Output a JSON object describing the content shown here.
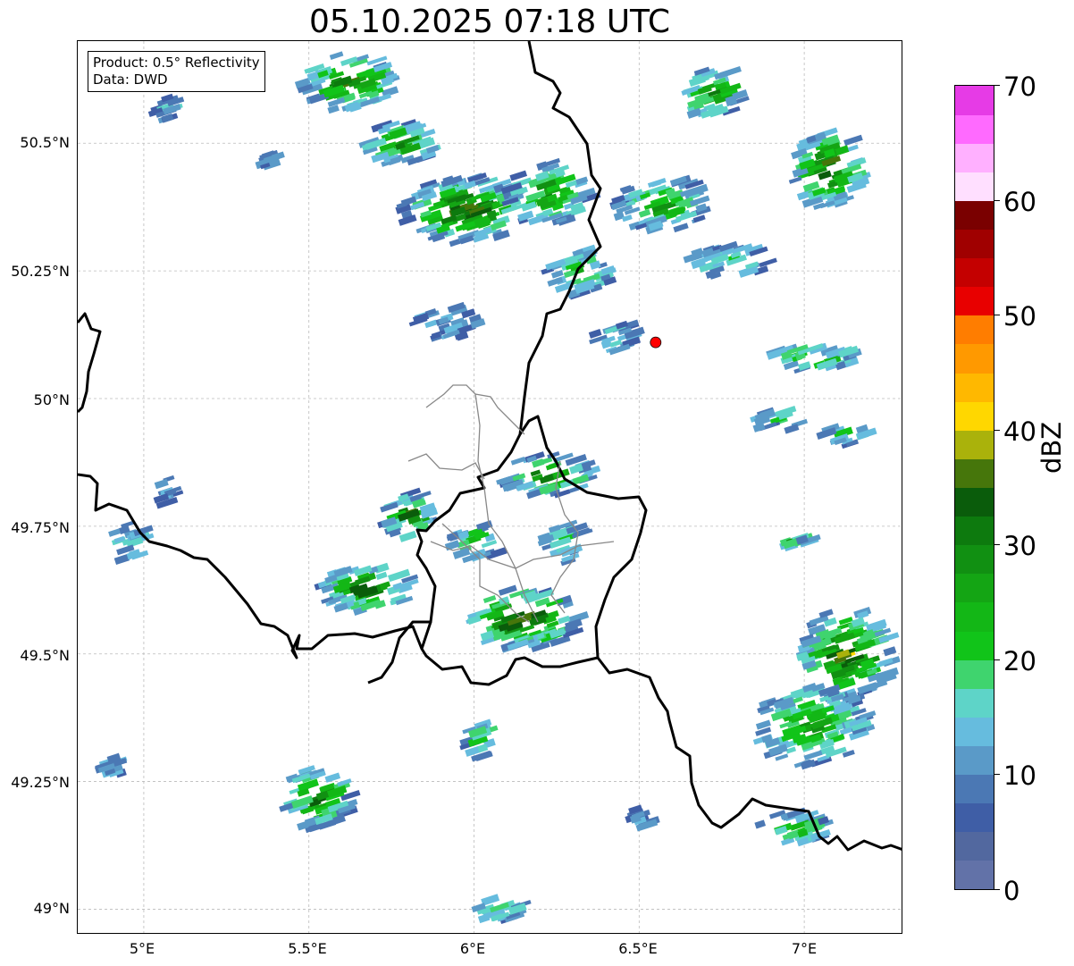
{
  "title": "05.10.2025 07:18 UTC",
  "infobox": {
    "product": "Product: 0.5° Reflectivity",
    "source": "Data: DWD"
  },
  "axes": {
    "lat_labels": [
      "50.5°N",
      "50.25°N",
      "50°N",
      "49.75°N",
      "49.5°N",
      "49.25°N",
      "49°N"
    ],
    "lon_labels": [
      "5°E",
      "5.5°E",
      "6°E",
      "6.5°E",
      "7°E"
    ],
    "lon_range": [
      4.8,
      7.3
    ],
    "lat_range": [
      48.95,
      50.7
    ],
    "grid": true
  },
  "radar_site": {
    "lon": 6.55,
    "lat": 50.11,
    "color": "#ff0000"
  },
  "colorbar": {
    "unit": "dBZ",
    "min": 0,
    "max": 70,
    "tick_labels": [
      "0",
      "10",
      "20",
      "30",
      "40",
      "50",
      "60",
      "70"
    ],
    "colors": [
      "#6272a8",
      "#52689f",
      "#3f5ea6",
      "#4b78b4",
      "#5a9ac8",
      "#66bcde",
      "#5ed4c8",
      "#3fd46e",
      "#11c419",
      "#13b716",
      "#14a514",
      "#119012",
      "#0d7a0e",
      "#0a5c0b",
      "#46760b",
      "#aab20b",
      "#ffd700",
      "#ffb800",
      "#ff9900",
      "#ff7d00",
      "#e80000",
      "#c40000",
      "#a00000",
      "#7a0000",
      "#ffdfff",
      "#ffb0ff",
      "#ff6aff",
      "#e63be6"
    ]
  },
  "echo_cells": [
    {
      "lon": 5.05,
      "lat": 50.57,
      "w": 0.08,
      "h": 0.05,
      "level": 5
    },
    {
      "lon": 5.35,
      "lat": 50.47,
      "w": 0.04,
      "h": 0.03,
      "level": 4
    },
    {
      "lon": 5.6,
      "lat": 50.62,
      "w": 0.3,
      "h": 0.11,
      "level": 14
    },
    {
      "lon": 5.75,
      "lat": 50.5,
      "w": 0.25,
      "h": 0.08,
      "level": 12
    },
    {
      "lon": 5.95,
      "lat": 50.37,
      "w": 0.38,
      "h": 0.13,
      "level": 15
    },
    {
      "lon": 6.2,
      "lat": 50.4,
      "w": 0.25,
      "h": 0.12,
      "level": 12
    },
    {
      "lon": 6.3,
      "lat": 50.25,
      "w": 0.2,
      "h": 0.09,
      "level": 10
    },
    {
      "lon": 6.55,
      "lat": 50.38,
      "w": 0.28,
      "h": 0.1,
      "level": 11
    },
    {
      "lon": 6.7,
      "lat": 50.6,
      "w": 0.18,
      "h": 0.1,
      "level": 12
    },
    {
      "lon": 7.05,
      "lat": 50.45,
      "w": 0.22,
      "h": 0.15,
      "level": 15
    },
    {
      "lon": 6.75,
      "lat": 50.27,
      "w": 0.25,
      "h": 0.06,
      "level": 8
    },
    {
      "lon": 5.9,
      "lat": 50.15,
      "w": 0.2,
      "h": 0.06,
      "level": 5
    },
    {
      "lon": 6.4,
      "lat": 50.12,
      "w": 0.12,
      "h": 0.07,
      "level": 6
    },
    {
      "lon": 7.0,
      "lat": 50.08,
      "w": 0.3,
      "h": 0.05,
      "level": 10
    },
    {
      "lon": 6.9,
      "lat": 49.96,
      "w": 0.18,
      "h": 0.04,
      "level": 8
    },
    {
      "lon": 7.1,
      "lat": 49.93,
      "w": 0.15,
      "h": 0.04,
      "level": 8
    },
    {
      "lon": 4.93,
      "lat": 49.72,
      "w": 0.12,
      "h": 0.07,
      "level": 6
    },
    {
      "lon": 5.05,
      "lat": 49.82,
      "w": 0.05,
      "h": 0.06,
      "level": 4
    },
    {
      "lon": 5.78,
      "lat": 49.77,
      "w": 0.16,
      "h": 0.09,
      "level": 14
    },
    {
      "lon": 5.65,
      "lat": 49.63,
      "w": 0.28,
      "h": 0.1,
      "level": 14
    },
    {
      "lon": 5.98,
      "lat": 49.72,
      "w": 0.15,
      "h": 0.07,
      "level": 11
    },
    {
      "lon": 6.2,
      "lat": 49.85,
      "w": 0.28,
      "h": 0.08,
      "level": 13
    },
    {
      "lon": 6.25,
      "lat": 49.72,
      "w": 0.12,
      "h": 0.08,
      "level": 9
    },
    {
      "lon": 6.12,
      "lat": 49.57,
      "w": 0.35,
      "h": 0.12,
      "level": 16
    },
    {
      "lon": 7.1,
      "lat": 49.5,
      "w": 0.28,
      "h": 0.18,
      "level": 15
    },
    {
      "lon": 7.0,
      "lat": 49.36,
      "w": 0.35,
      "h": 0.16,
      "level": 11
    },
    {
      "lon": 6.95,
      "lat": 49.72,
      "w": 0.08,
      "h": 0.02,
      "level": 12
    },
    {
      "lon": 5.5,
      "lat": 49.22,
      "w": 0.2,
      "h": 0.12,
      "level": 14
    },
    {
      "lon": 6.0,
      "lat": 49.33,
      "w": 0.1,
      "h": 0.07,
      "level": 9
    },
    {
      "lon": 4.88,
      "lat": 49.28,
      "w": 0.08,
      "h": 0.04,
      "level": 5
    },
    {
      "lon": 6.05,
      "lat": 49.0,
      "w": 0.15,
      "h": 0.05,
      "level": 8
    },
    {
      "lon": 6.48,
      "lat": 49.18,
      "w": 0.05,
      "h": 0.04,
      "level": 4
    },
    {
      "lon": 6.95,
      "lat": 49.16,
      "w": 0.22,
      "h": 0.06,
      "level": 11
    }
  ]
}
